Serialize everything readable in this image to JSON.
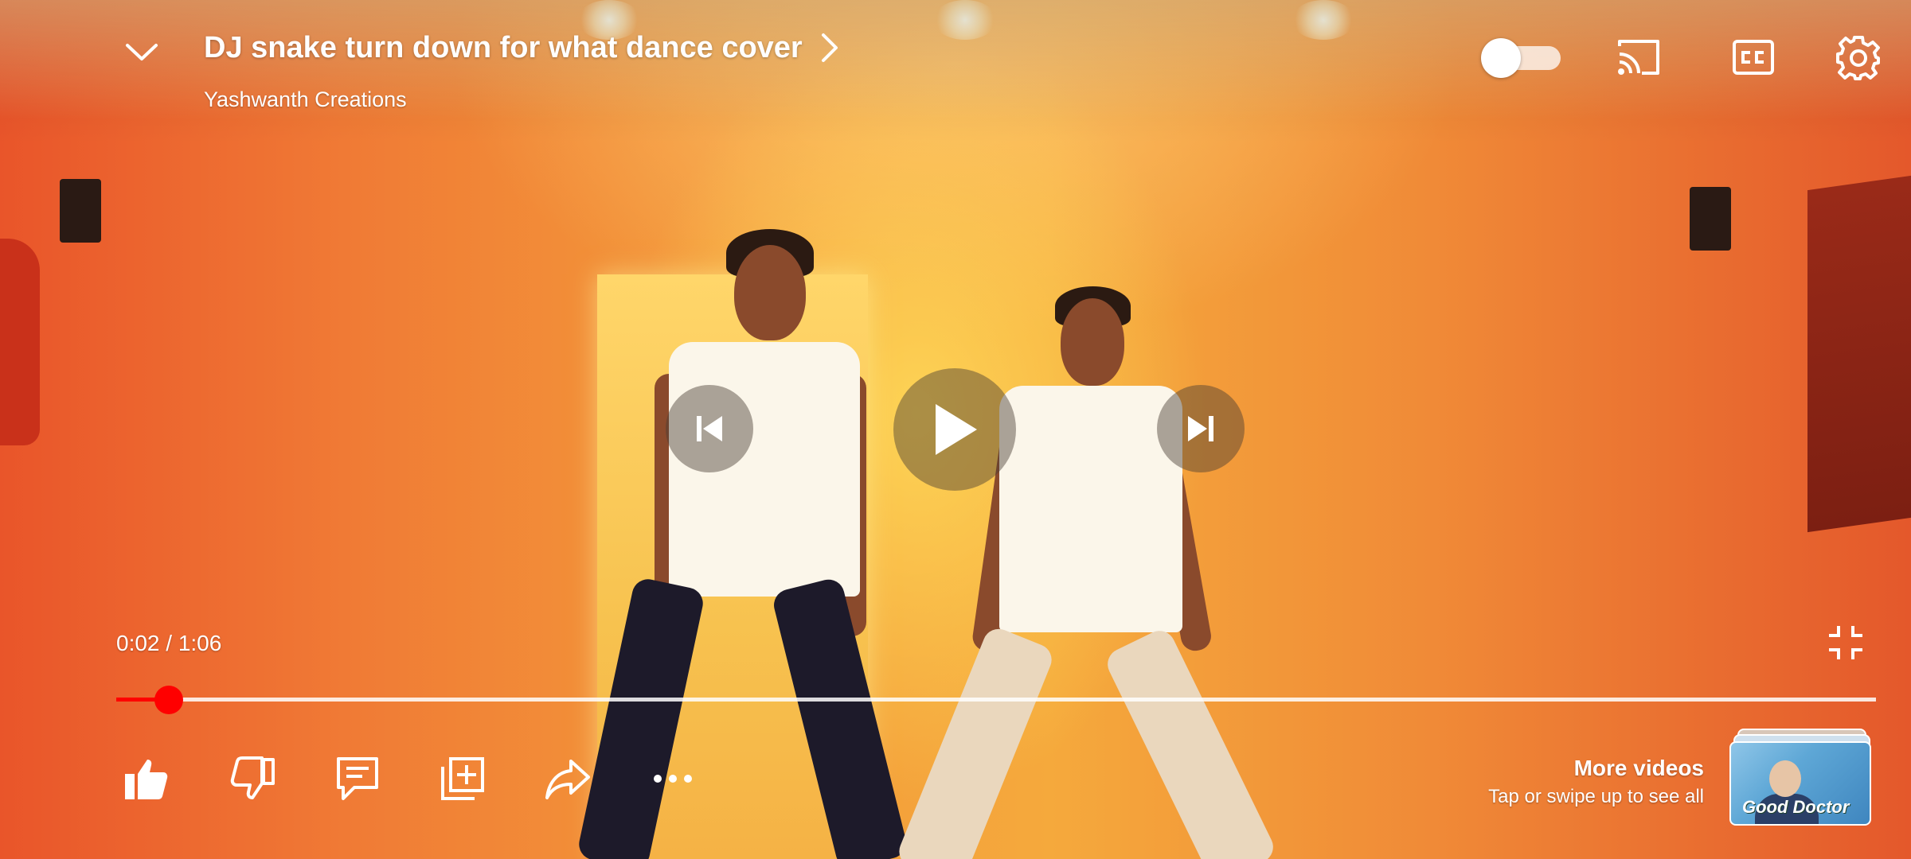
{
  "player": {
    "title": "DJ snake turn down for what  dance cover",
    "channel": "Yashwanth Creations",
    "icons": {
      "collapse": "chevron-down-icon",
      "title_more": "chevron-right-icon",
      "autoplay": "autoplay-toggle",
      "cast": "cast-icon",
      "captions": "cc-icon",
      "settings": "gear-icon",
      "previous": "skip-previous-icon",
      "play": "play-icon",
      "next": "skip-next-icon",
      "exit_fullscreen": "exit-fullscreen-icon"
    },
    "time": {
      "display": "0:02 / 1:06",
      "progress_fraction": 0.03
    },
    "autoplay_on": false
  },
  "actions": [
    {
      "name": "like",
      "icon": "thumbs-up-icon"
    },
    {
      "name": "dislike",
      "icon": "thumbs-down-icon"
    },
    {
      "name": "comments",
      "icon": "comment-icon"
    },
    {
      "name": "save",
      "icon": "add-to-playlist-icon"
    },
    {
      "name": "share",
      "icon": "share-icon"
    },
    {
      "name": "more",
      "icon": "more-horizontal-icon"
    }
  ],
  "more_videos": {
    "title": "More videos",
    "subtitle": "Tap or swipe up to see all",
    "thumbnail_text": "Good Doctor"
  },
  "colors": {
    "progress": "#ff0000",
    "icon": "#ffffff"
  }
}
